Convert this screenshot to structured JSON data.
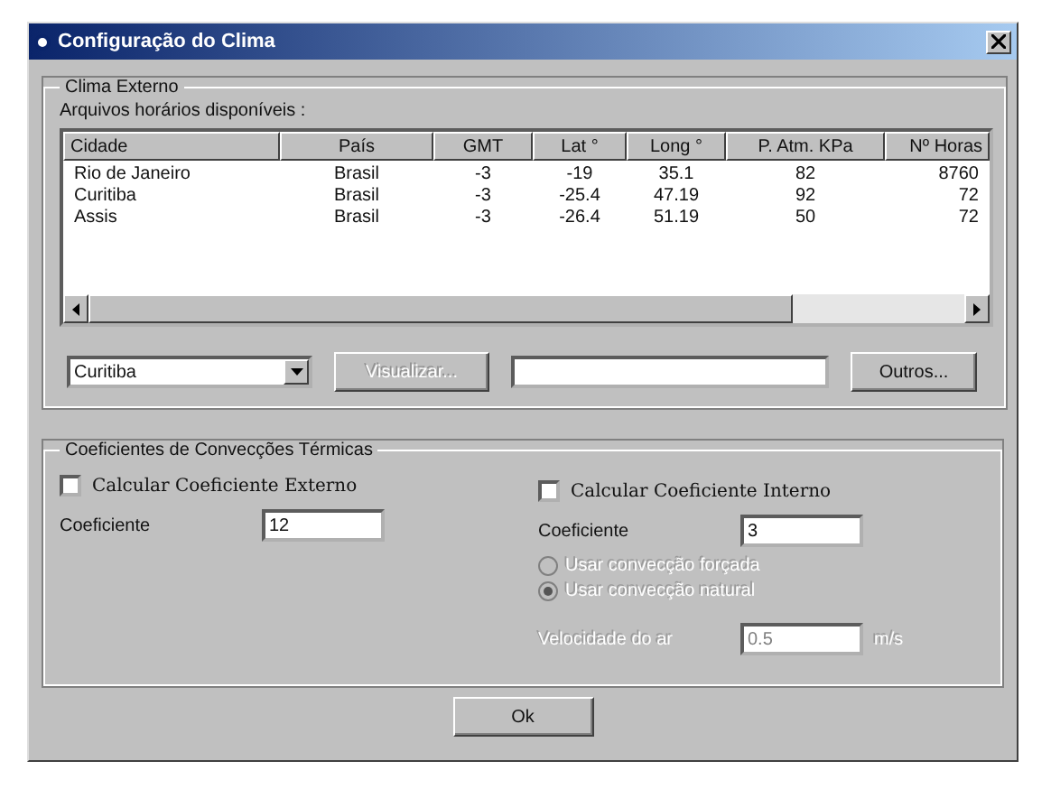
{
  "window": {
    "title": "Configuração do Clima"
  },
  "external_climate": {
    "title": "Clima Externo",
    "files_label": "Arquivos horários disponíveis :",
    "table": {
      "columns": [
        "Cidade",
        "País",
        "GMT",
        "Lat °",
        "Long °",
        "P. Atm. KPa",
        "Nº Horas"
      ],
      "rows": [
        [
          "Rio de Janeiro",
          "Brasil",
          "-3",
          "-19",
          "35.1",
          "82",
          "8760"
        ],
        [
          "Curitiba",
          "Brasil",
          "-3",
          "-25.4",
          "47.19",
          "92",
          "72"
        ],
        [
          "Assis",
          "Brasil",
          "-3",
          "-26.4",
          "51.19",
          "50",
          "72"
        ]
      ]
    },
    "city_select": {
      "value": "Curitiba"
    },
    "view_button": {
      "label": "Visualizar...",
      "disabled": true
    },
    "others_button": {
      "label": "Outros..."
    }
  },
  "convection": {
    "title": "Coeficientes de Convecções Térmicas",
    "external": {
      "checkbox": {
        "label": "Calcular Coeficiente Externo",
        "checked": false
      },
      "coef_label": "Coeficiente",
      "coef_value": "12"
    },
    "internal": {
      "checkbox": {
        "label": "Calcular Coeficiente Interno",
        "checked": false
      },
      "coef_label": "Coeficiente",
      "coef_value": "3",
      "radios": [
        {
          "label": "Usar convecção forçada",
          "selected": false,
          "disabled": true
        },
        {
          "label": "Usar convecção natural",
          "selected": true,
          "disabled": true
        }
      ],
      "speed": {
        "label": "Velocidade do ar",
        "value": "0.5",
        "unit": "m/s",
        "disabled": true
      }
    }
  },
  "ok_button": {
    "label": "Ok"
  }
}
